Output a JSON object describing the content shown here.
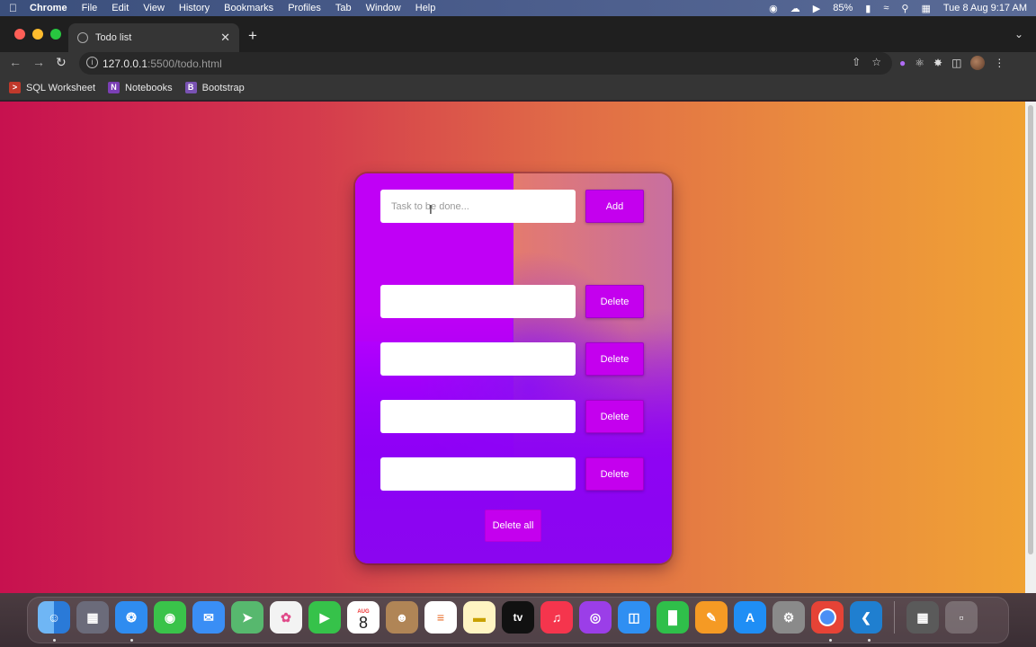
{
  "menubar": {
    "app": "Chrome",
    "items": [
      "File",
      "Edit",
      "View",
      "History",
      "Bookmarks",
      "Profiles",
      "Tab",
      "Window",
      "Help"
    ],
    "battery": "85%",
    "datetime": "Tue 8 Aug  9:17 AM"
  },
  "browser": {
    "tab_title": "Todo list",
    "url_host": "127.0.0.1",
    "url_path": ":5500/todo.html",
    "bookmarks": [
      {
        "label": "SQL Worksheet",
        "icon": "sql-icon",
        "color": "#c0392b"
      },
      {
        "label": "Notebooks",
        "icon": "onenote-icon",
        "color": "#7b3fb5"
      },
      {
        "label": "Bootstrap",
        "icon": "bootstrap-icon",
        "color": "#7952b3"
      }
    ]
  },
  "todo": {
    "input_placeholder": "Task to be done...",
    "add_label": "Add",
    "tasks": [
      {
        "value": "",
        "delete_label": "Delete"
      },
      {
        "value": "",
        "delete_label": "Delete"
      },
      {
        "value": "",
        "delete_label": "Delete"
      },
      {
        "value": "",
        "delete_label": "Delete"
      }
    ],
    "delete_all_label": "Delete all"
  },
  "dock": {
    "apps": [
      "finder-icon",
      "launchpad-icon",
      "safari-icon",
      "messages-icon",
      "mail-icon",
      "maps-icon",
      "photos-icon",
      "facetime-icon",
      "calendar-icon",
      "contacts-icon",
      "reminders-icon",
      "notes-icon",
      "appletv-icon",
      "music-icon",
      "podcasts-icon",
      "keynote-icon",
      "numbers-icon",
      "pages-icon",
      "appstore-icon",
      "settings-icon",
      "chrome-icon",
      "vscode-icon",
      "calculator-icon",
      "trash-icon"
    ],
    "calendar_month": "AUG",
    "calendar_day": "8",
    "tv_label": "tv"
  },
  "colors": {
    "accent": "#c400ee",
    "page_gradient_start": "#c7114f",
    "page_gradient_end": "#f0a234"
  }
}
